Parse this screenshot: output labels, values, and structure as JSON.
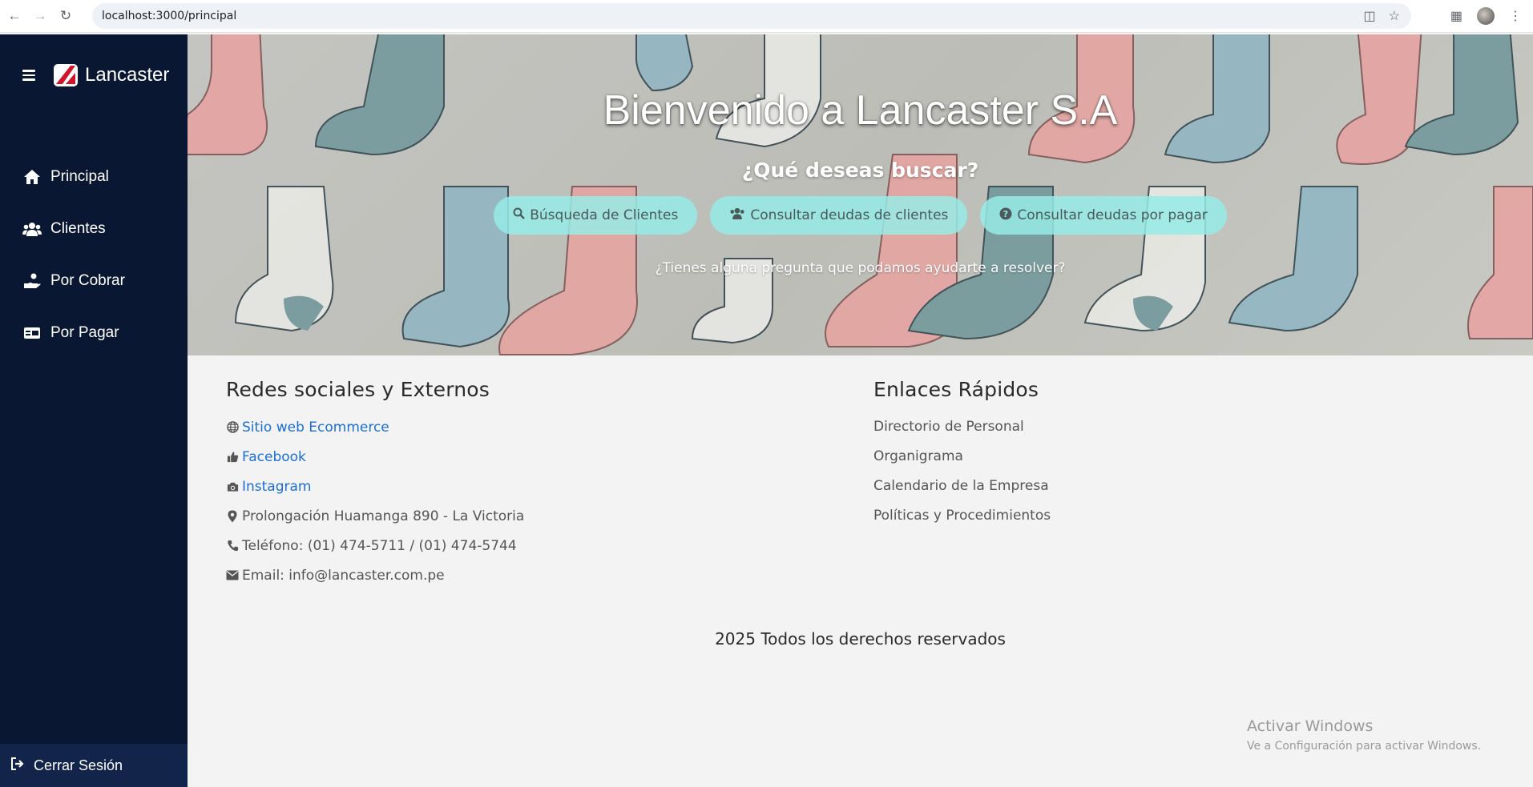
{
  "browser": {
    "url": "localhost:3000/principal"
  },
  "sidebar": {
    "brand": "Lancaster",
    "items": [
      {
        "label": "Principal",
        "icon": "home-icon"
      },
      {
        "label": "Clientes",
        "icon": "users-icon"
      },
      {
        "label": "Por Cobrar",
        "icon": "hand-coin-icon"
      },
      {
        "label": "Por Pagar",
        "icon": "card-icon"
      }
    ],
    "logout_label": "Cerrar Sesión"
  },
  "hero": {
    "title": "Bienvenido a Lancaster S.A",
    "subtitle": "¿Qué deseas buscar?",
    "buttons": [
      {
        "label": "Búsqueda de Clientes",
        "icon": "search-icon"
      },
      {
        "label": "Consultar deudas de clientes",
        "icon": "users-icon"
      },
      {
        "label": "Consultar deudas por pagar",
        "icon": "question-circle-icon"
      }
    ],
    "question": "¿Tienes alguna pregunta que podamos ayudarte a resolver?"
  },
  "social": {
    "heading": "Redes sociales y Externos",
    "links": [
      {
        "label": "Sitio web Ecommerce",
        "icon": "globe-icon"
      },
      {
        "label": "Facebook",
        "icon": "thumbs-up-icon"
      },
      {
        "label": "Instagram",
        "icon": "camera-icon"
      }
    ],
    "address": "Prolongación Huamanga 890 - La Victoria",
    "phone": "Teléfono: (01) 474-5711 / (01) 474-5744",
    "email": "Email: info@lancaster.com.pe"
  },
  "quick_links": {
    "heading": "Enlaces Rápidos",
    "items": [
      "Directorio de Personal",
      "Organigrama",
      "Calendario de la Empresa",
      "Políticas y Procedimientos"
    ]
  },
  "footer": {
    "text": "2025 Todos los derechos reservados"
  },
  "watermark": {
    "line1": "Activar Windows",
    "line2": "Ve a Configuración para activar Windows."
  },
  "colors": {
    "sidebar_bg": "#0a1733",
    "hero_button": "#96ebe6",
    "link": "#1a6ed8"
  }
}
